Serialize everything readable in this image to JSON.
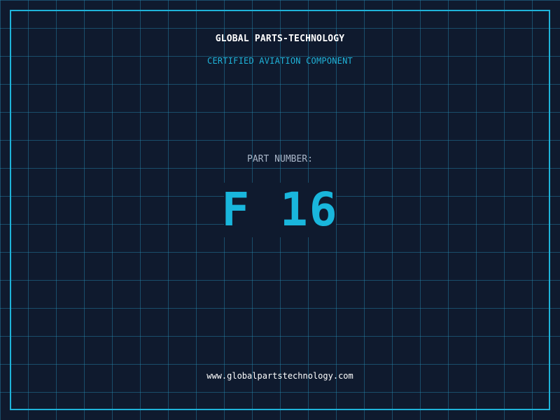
{
  "header": {
    "company": "GLOBAL PARTS-TECHNOLOGY",
    "tagline": "CERTIFIED AVIATION COMPONENT"
  },
  "part": {
    "label": "PART NUMBER:",
    "number": "F 16"
  },
  "footer": {
    "website": "www.globalpartstechnology.com"
  },
  "colors": {
    "background": "#0f1a2e",
    "grid": "#288cb4",
    "accent": "#1fb3d9",
    "text": "#ffffff",
    "muted": "#a9b6c8"
  }
}
